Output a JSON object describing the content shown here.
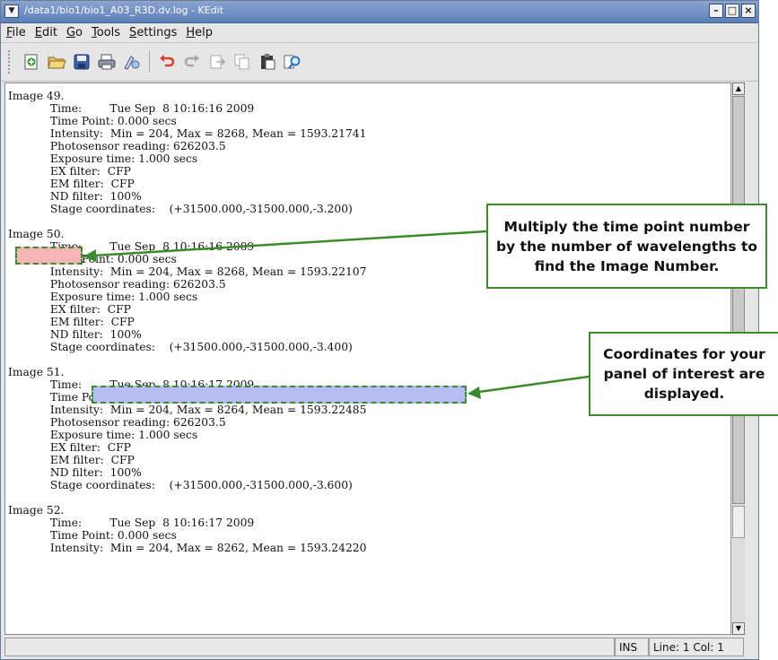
{
  "window": {
    "title": "/data1/bio1/bio1_A03_R3D.dv.log - KEdit"
  },
  "menubar": {
    "items": [
      {
        "label": "File"
      },
      {
        "label": "Edit"
      },
      {
        "label": "Go"
      },
      {
        "label": "Tools"
      },
      {
        "label": "Settings"
      },
      {
        "label": "Help"
      }
    ]
  },
  "toolbar": {
    "buttons": [
      "new-file-icon",
      "open-folder-icon",
      "save-icon",
      "print-icon",
      "spellcheck-icon",
      "undo-icon",
      "redo-icon",
      "cut-icon",
      "copy-icon",
      "paste-icon",
      "find-icon"
    ]
  },
  "log": {
    "lines": [
      "Image 49.",
      "            Time:        Tue Sep  8 10:16:16 2009",
      "            Time Point: 0.000 secs",
      "            Intensity:  Min = 204, Max = 8268, Mean = 1593.21741",
      "            Photosensor reading: 626203.5",
      "            Exposure time: 1.000 secs",
      "            EX filter:  CFP",
      "            EM filter:  CFP",
      "            ND filter:  100%",
      "            Stage coordinates:    (+31500.000,-31500.000,-3.200)",
      "",
      "Image 50.",
      "            Time:        Tue Sep  8 10:16:16 2009",
      "            Time Point: 0.000 secs",
      "            Intensity:  Min = 204, Max = 8268, Mean = 1593.22107",
      "            Photosensor reading: 626203.5",
      "            Exposure time: 1.000 secs",
      "            EX filter:  CFP",
      "            EM filter:  CFP",
      "            ND filter:  100%",
      "            Stage coordinates:    (+31500.000,-31500.000,-3.400)",
      "",
      "Image 51.",
      "            Time:        Tue Sep  8 10:16:17 2009",
      "            Time Point: 0.000 secs",
      "            Intensity:  Min = 204, Max = 8264, Mean = 1593.22485",
      "            Photosensor reading: 626203.5",
      "            Exposure time: 1.000 secs",
      "            EX filter:  CFP",
      "            EM filter:  CFP",
      "            ND filter:  100%",
      "            Stage coordinates:    (+31500.000,-31500.000,-3.600)",
      "",
      "Image 52.",
      "            Time:        Tue Sep  8 10:16:17 2009",
      "            Time Point: 0.000 secs",
      "            Intensity:  Min = 204, Max = 8262, Mean = 1593.24220"
    ]
  },
  "statusbar": {
    "mode": "INS",
    "position": "Line: 1 Col: 1"
  },
  "annotations": {
    "callout_image_number": "Multiply the time point number by the number of wavelengths to find the Image Number.",
    "callout_coordinates": "Coordinates for your panel of interest are displayed."
  },
  "colors": {
    "highlight_image": "#f6b6b6",
    "highlight_coords": "#b7bdf4",
    "annotation_green": "#3b8a2b"
  }
}
